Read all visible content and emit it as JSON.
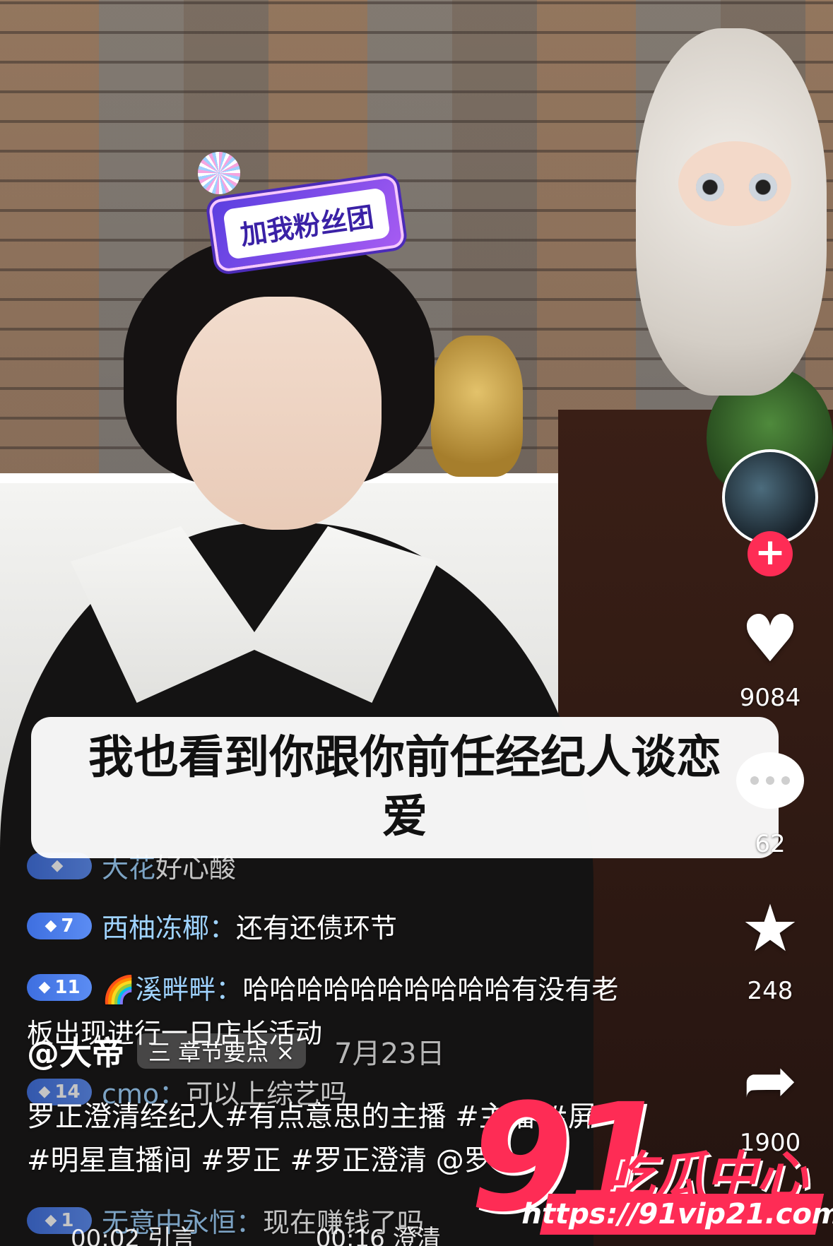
{
  "sticker": {
    "label": "加我粉丝团"
  },
  "caption": {
    "text": "我也看到你跟你前任经纪人谈恋爱"
  },
  "comments": [
    {
      "level": "",
      "name": "大花",
      "text": "好心酸",
      "partial": true
    },
    {
      "level": "7",
      "name": "西柚冻椰：",
      "text": "还有还债环节"
    },
    {
      "level": "11",
      "name": "🌈溪畔畔：",
      "text": "哈哈哈哈哈哈哈哈哈哈有没有老"
    },
    {
      "level": "",
      "name": "",
      "text": "板出现进行一日店长活动"
    },
    {
      "level": "14",
      "name": "cmo：",
      "text": "可以上综艺吗"
    },
    {
      "level": "1",
      "name": "无意中永恒：",
      "text": "现在赚钱了吗"
    }
  ],
  "rail": {
    "like_count": "9084",
    "comment_count": "62",
    "favorite_count": "248",
    "share_count": "1900"
  },
  "post": {
    "author": "@大帝",
    "chapter_label": "三 章节要点 ×",
    "date": "7月23日",
    "description_line1": "罗正澄清经纪人#有点意思的主播 #主播 #屏",
    "description_line2": "#明星直播间 #罗正 #罗正澄清 @罗 ..."
  },
  "bottom_bar": {
    "text": "00:02 引言　　　　　00:16 澄清"
  },
  "watermark": {
    "number": "91",
    "name": "吃瓜中心",
    "url": "https://91vip21.com"
  },
  "colors": {
    "accent": "#fe2c55",
    "level_badge": "#3e6fe0",
    "username": "#9fd3ff"
  }
}
